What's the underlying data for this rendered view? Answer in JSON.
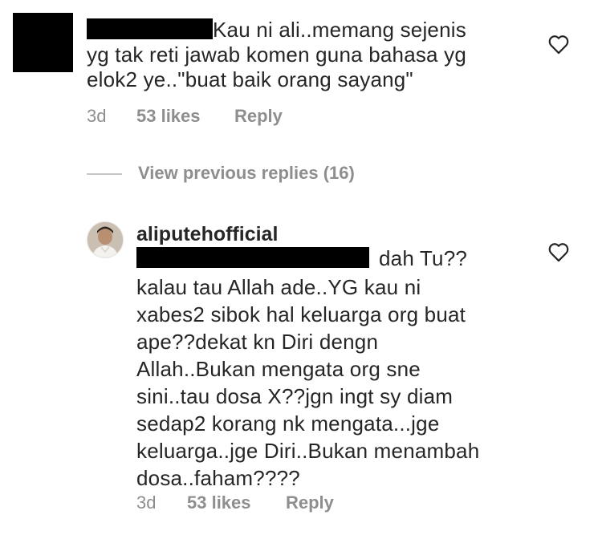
{
  "comment1": {
    "text_lines": [
      "Kau ni ali..memang sejenis",
      "yg tak reti jawab komen guna bahasa yg",
      "elok2 ye..\"buat baik orang sayang\""
    ],
    "time": "3d",
    "likes": "53 likes",
    "reply_label": "Reply",
    "heart_icon": "heart-outline-icon"
  },
  "view_previous_replies": "View previous replies (16)",
  "comment2": {
    "username": "aliputehofficial",
    "text_lines": [
      "dah Tu??",
      "kalau tau Allah ade..YG kau ni",
      "xabes2 sibok hal keluarga org buat",
      "ape??dekat kn Diri dengn",
      "Allah..Bukan mengata org sne",
      "sini..tau dosa X??jgn ingt sy diam",
      "sedap2 korang nk mengata...jge",
      "keluarga..jge Diri..Bukan menambah",
      "dosa..faham????"
    ],
    "time": "3d",
    "likes": "53 likes",
    "reply_label": "Reply",
    "heart_icon": "heart-outline-icon"
  }
}
